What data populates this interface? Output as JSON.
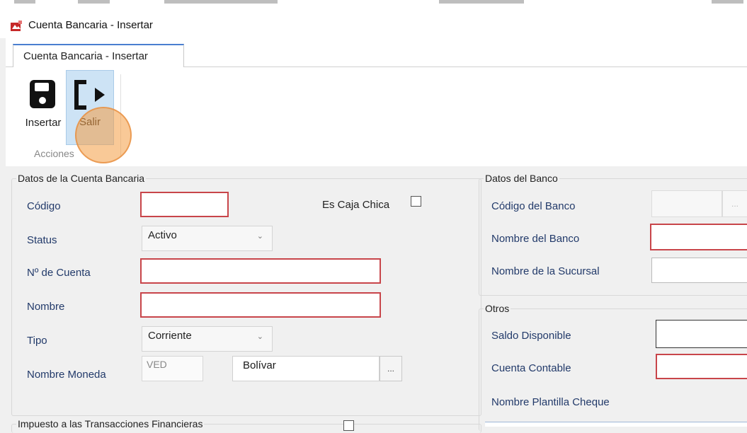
{
  "window": {
    "title": "Cuenta Bancaria - Insertar"
  },
  "tab": {
    "label": "Cuenta Bancaria - Insertar"
  },
  "ribbon": {
    "insert_label": "Insertar",
    "exit_label": "Salir",
    "group_label": "Acciones"
  },
  "datos_cuenta": {
    "legend": "Datos de la Cuenta Bancaria",
    "codigo_label": "Código",
    "caja_chica_label": "Es Caja Chica",
    "status_label": "Status",
    "status_value": "Activo",
    "num_cuenta_label": "Nº de Cuenta",
    "nombre_label": "Nombre",
    "tipo_label": "Tipo",
    "tipo_value": "Corriente",
    "moneda_label": "Nombre Moneda",
    "moneda_code": "VED",
    "moneda_name": "Bolívar",
    "ellipsis": "..."
  },
  "datos_banco": {
    "legend": "Datos del Banco",
    "codigo_banco_label": "Código del Banco",
    "nombre_banco_label": "Nombre del Banco",
    "sucursal_label": "Nombre de la Sucursal",
    "ellipsis": "..."
  },
  "otros": {
    "legend": "Otros",
    "saldo_label": "Saldo Disponible",
    "cuenta_contable_label": "Cuenta Contable",
    "plantilla_label": "Nombre Plantilla Cheque"
  },
  "itf": {
    "legend": "Impuesto a las Transacciones Financieras"
  }
}
